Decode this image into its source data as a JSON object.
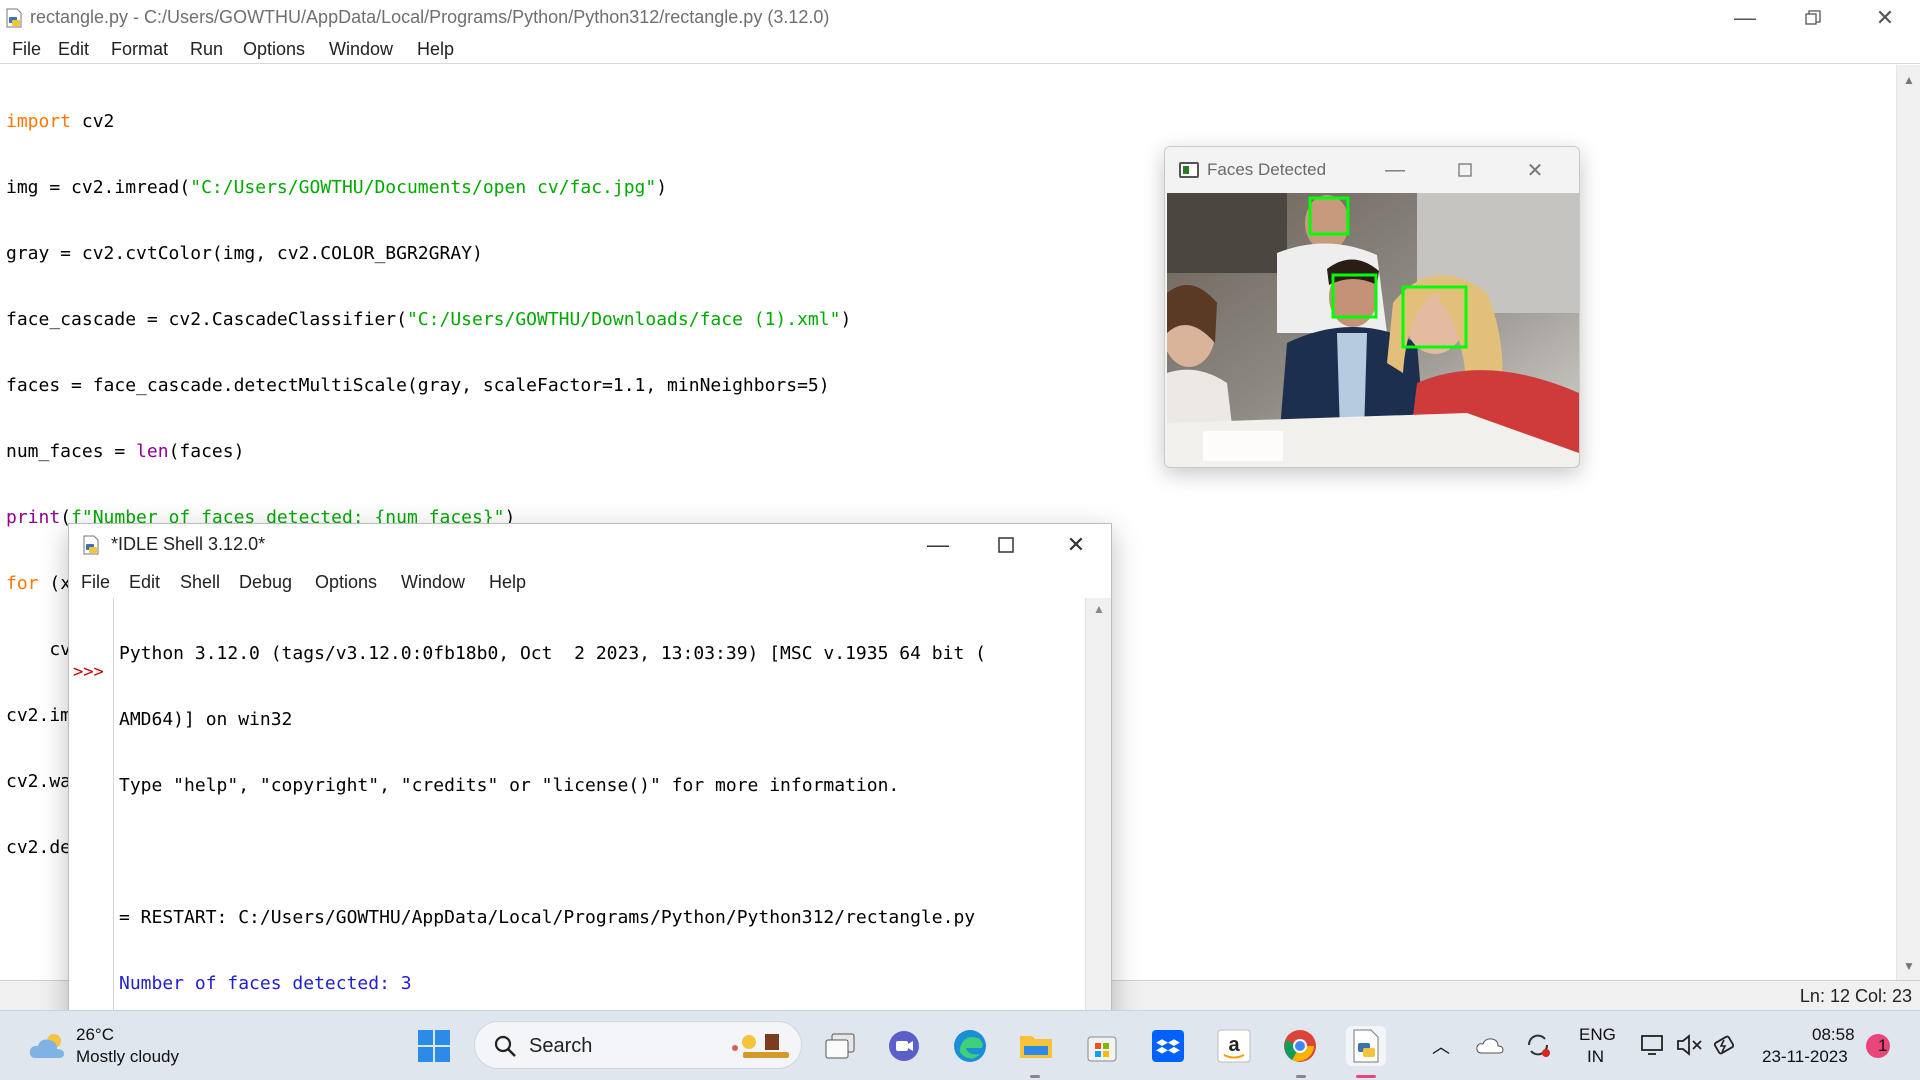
{
  "editor_window": {
    "title": "rectangle.py - C:/Users/GOWTHU/AppData/Local/Programs/Python/Python312/rectangle.py (3.12.0)",
    "menu": [
      "File",
      "Edit",
      "Format",
      "Run",
      "Options",
      "Window",
      "Help"
    ],
    "status": "Ln: 12  Col: 23",
    "code_lines": [
      "import cv2",
      "img = cv2.imread(\"C:/Users/GOWTHU/Documents/open cv/fac.jpg\")",
      "gray = cv2.cvtColor(img, cv2.COLOR_BGR2GRAY)",
      "face_cascade = cv2.CascadeClassifier(\"C:/Users/GOWTHU/Downloads/face (1).xml\")",
      "faces = face_cascade.detectMultiScale(gray, scaleFactor=1.1, minNeighbors=5)",
      "num_faces = len(faces)",
      "print(f\"Number of faces detected: {num_faces}\")",
      "for (x, y, w, h) in faces:",
      "    cv2.rectangle(img, (x, y), (x + w, y + h), (0, 255, 0), 2)",
      "cv2.imshow('Faces Detected', img)",
      "cv2.waitKey(0)",
      "cv2.destroyAllWindows()"
    ]
  },
  "faces_window": {
    "title": "Faces Detected"
  },
  "shell_window": {
    "title": "*IDLE Shell 3.12.0*",
    "menu": [
      "File",
      "Edit",
      "Shell",
      "Debug",
      "Options",
      "Window",
      "Help"
    ],
    "prompt": ">>>",
    "lines": [
      "Python 3.12.0 (tags/v3.12.0:0fb18b0, Oct  2 2023, 13:03:39) [MSC v.1935 64 bit (",
      "AMD64)] on win32",
      "Type \"help\", \"copyright\", \"credits\" or \"license()\" for more information.",
      "",
      "= RESTART: C:/Users/GOWTHU/AppData/Local/Programs/Python/Python312/rectangle.py"
    ],
    "output": "Number of faces detected: 3"
  },
  "taskbar": {
    "weather_temp": "26°C",
    "weather_condition": "Mostly cloudy",
    "search_label": "Search",
    "language_line1": "ENG",
    "language_line2": "IN",
    "time": "08:58",
    "date": "23-11-2023",
    "notification_count": "1"
  },
  "colors": {
    "keyword": "#ff7700",
    "string": "#00aa00",
    "builtin": "#900090",
    "shell_output": "#2020d0",
    "prompt": "#c00000",
    "detection_box": "#00ff00"
  }
}
